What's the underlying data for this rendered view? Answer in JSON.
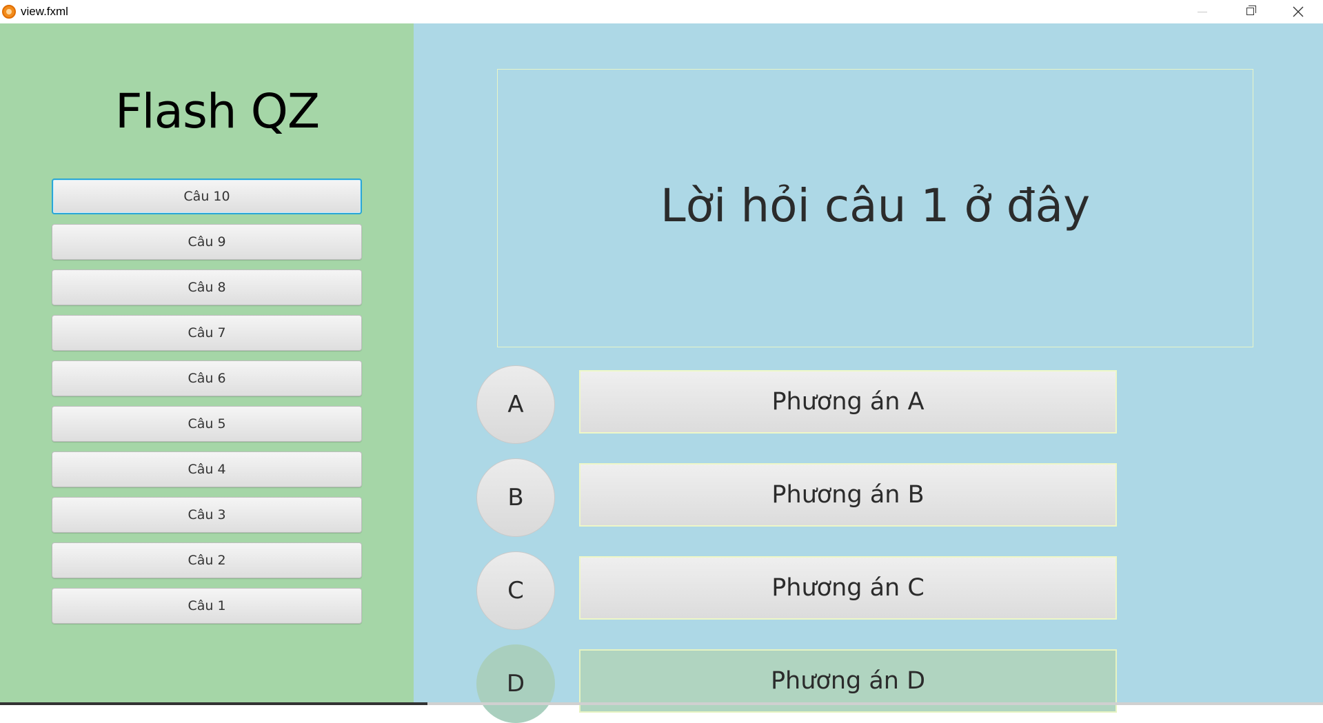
{
  "window": {
    "title": "view.fxml",
    "app_icon": "app-logo-icon",
    "controls": [
      "minimize-icon",
      "restore-icon",
      "close-icon"
    ]
  },
  "sidebar": {
    "heading": "Flash QZ",
    "background": "#a5d6a7",
    "questions": [
      {
        "label": "Câu 10",
        "focused": true
      },
      {
        "label": "Câu 9"
      },
      {
        "label": "Câu 8"
      },
      {
        "label": "Câu 7"
      },
      {
        "label": "Câu 6"
      },
      {
        "label": "Câu 5"
      },
      {
        "label": "Câu 4"
      },
      {
        "label": "Câu 3"
      },
      {
        "label": "Câu 2"
      },
      {
        "label": "Câu 1"
      }
    ]
  },
  "main": {
    "background": "#add8e6",
    "question_text": "Lời hỏi câu 1 ở đây",
    "options": [
      {
        "letter": "A",
        "label": "Phương án A"
      },
      {
        "letter": "B",
        "label": "Phương án B"
      },
      {
        "letter": "C",
        "label": "Phương án C"
      },
      {
        "letter": "D",
        "label": "Phương án D",
        "highlighted": true
      }
    ]
  },
  "colors": {
    "focus_ring": "#2aa6d6",
    "option_d_highlight": "#b0d4c0"
  }
}
